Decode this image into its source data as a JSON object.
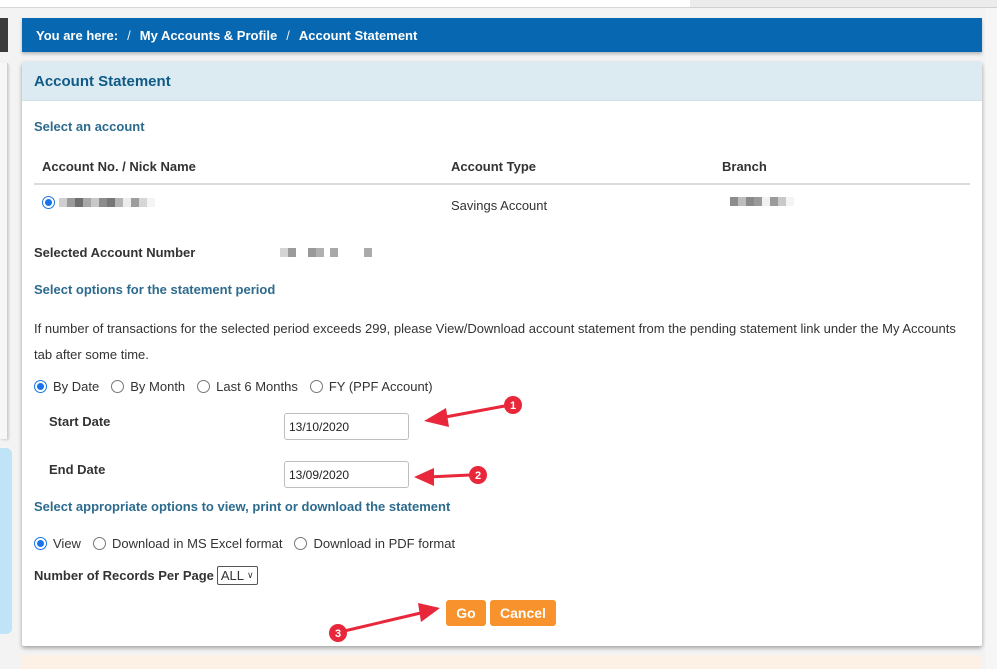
{
  "breadcrumb": {
    "prefix": "You are here:",
    "separator": "/",
    "items": [
      "My Accounts & Profile",
      "Account Statement"
    ]
  },
  "panel": {
    "title": "Account Statement",
    "select_account_title": "Select an account",
    "table": {
      "headers": [
        "Account No. / Nick Name",
        "Account Type",
        "Branch"
      ],
      "rows": [
        {
          "selected": true,
          "account_no": "[redacted]",
          "account_type": "Savings Account",
          "branch": "[redacted]"
        }
      ]
    },
    "selected_account_label": "Selected Account Number",
    "selected_account_value": "[redacted]",
    "period_title": "Select options for the statement period",
    "notice": "If number of transactions for the selected period exceeds 299, please View/Download account statement from the pending statement link under the My Accounts tab after some time.",
    "period_options": [
      {
        "label": "By Date",
        "selected": true
      },
      {
        "label": "By Month",
        "selected": false
      },
      {
        "label": "Last 6 Months",
        "selected": false
      },
      {
        "label": "FY (PPF Account)",
        "selected": false
      }
    ],
    "start_date_label": "Start Date",
    "start_date_value": "13/10/2020",
    "end_date_label": "End Date",
    "end_date_value": "13/09/2020",
    "output_title": "Select appropriate options to view, print or download the statement",
    "output_options": [
      {
        "label": "View",
        "selected": true
      },
      {
        "label": "Download in MS Excel format",
        "selected": false
      },
      {
        "label": "Download in PDF format",
        "selected": false
      }
    ],
    "records_label": "Number of Records Per Page",
    "records_value": "ALL",
    "go_label": "Go",
    "cancel_label": "Cancel"
  },
  "annotations": [
    {
      "number": "1",
      "target": "start-date-input"
    },
    {
      "number": "2",
      "target": "end-date-input"
    },
    {
      "number": "3",
      "target": "go-button"
    }
  ],
  "colors": {
    "breadcrumb_bg": "#0767b1",
    "panel_header_bg": "#dbebf1",
    "section_title": "#2d6b8e",
    "button_orange": "#f7922c",
    "annotation_red": "#e8283a",
    "radio_blue": "#1a73e8"
  }
}
